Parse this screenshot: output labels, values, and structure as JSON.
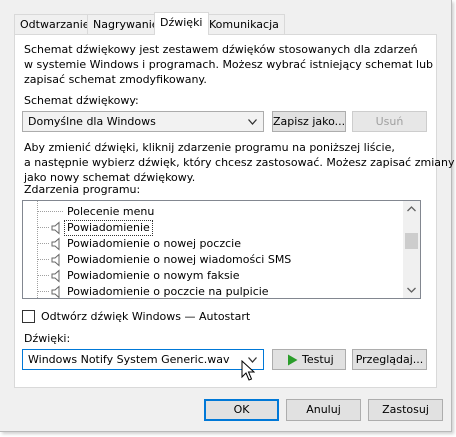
{
  "tabs": [
    {
      "label": "Odtwarzanie"
    },
    {
      "label": "Nagrywanie"
    },
    {
      "label": "Dźwięki"
    },
    {
      "label": "Komunikacja"
    }
  ],
  "active_tab": "Dźwięki",
  "intro_text": [
    "Schemat dźwiękowy jest zestawem dźwięków stosowanych dla zdarzeń",
    "w systemie Windows i programach. Możesz wybrać istniejący schemat lub",
    "zapisać schemat zmodyfikowany."
  ],
  "scheme_label": "Schemat dźwiękowy:",
  "scheme_value": "Domyślne dla Windows",
  "save_as_label": "Zapisz jako...",
  "delete_label": "Usuń",
  "change_text": [
    "Aby zmienić dźwięki, kliknij zdarzenie programu na poniższej liście,",
    "a następnie wybierz dźwięk, który chcesz zastosować. Możesz zapisać zmiany",
    "jako nowy schemat dźwiękowy."
  ],
  "events_label": "Zdarzenia programu:",
  "events": [
    {
      "label": "Polecenie menu",
      "icon": "none"
    },
    {
      "label": "Powiadomienie",
      "icon": "speaker-icon"
    },
    {
      "label": "Powiadomienie o nowej poczcie",
      "icon": "speaker-icon"
    },
    {
      "label": "Powiadomienie o nowej wiadomości SMS",
      "icon": "speaker-icon"
    },
    {
      "label": "Powiadomienie o nowym faksie",
      "icon": "speaker-icon"
    },
    {
      "label": "Powiadomienie o poczcie na pulpicie",
      "icon": "speaker-icon"
    }
  ],
  "selected_event": "Powiadomienie",
  "startup_checkbox_label": "Odtwórz dźwięk Windows — Autostart",
  "startup_checked": false,
  "sounds_label": "Dźwięki:",
  "sound_value": "Windows Notify System Generic.wav",
  "test_label": "Testuj",
  "browse_label": "Przeglądaj...",
  "ok_label": "OK",
  "cancel_label": "Anuluj",
  "apply_label": "Zastosuj",
  "colors": {
    "accent": "#0078d7",
    "play_green": "#2a9d2a"
  }
}
